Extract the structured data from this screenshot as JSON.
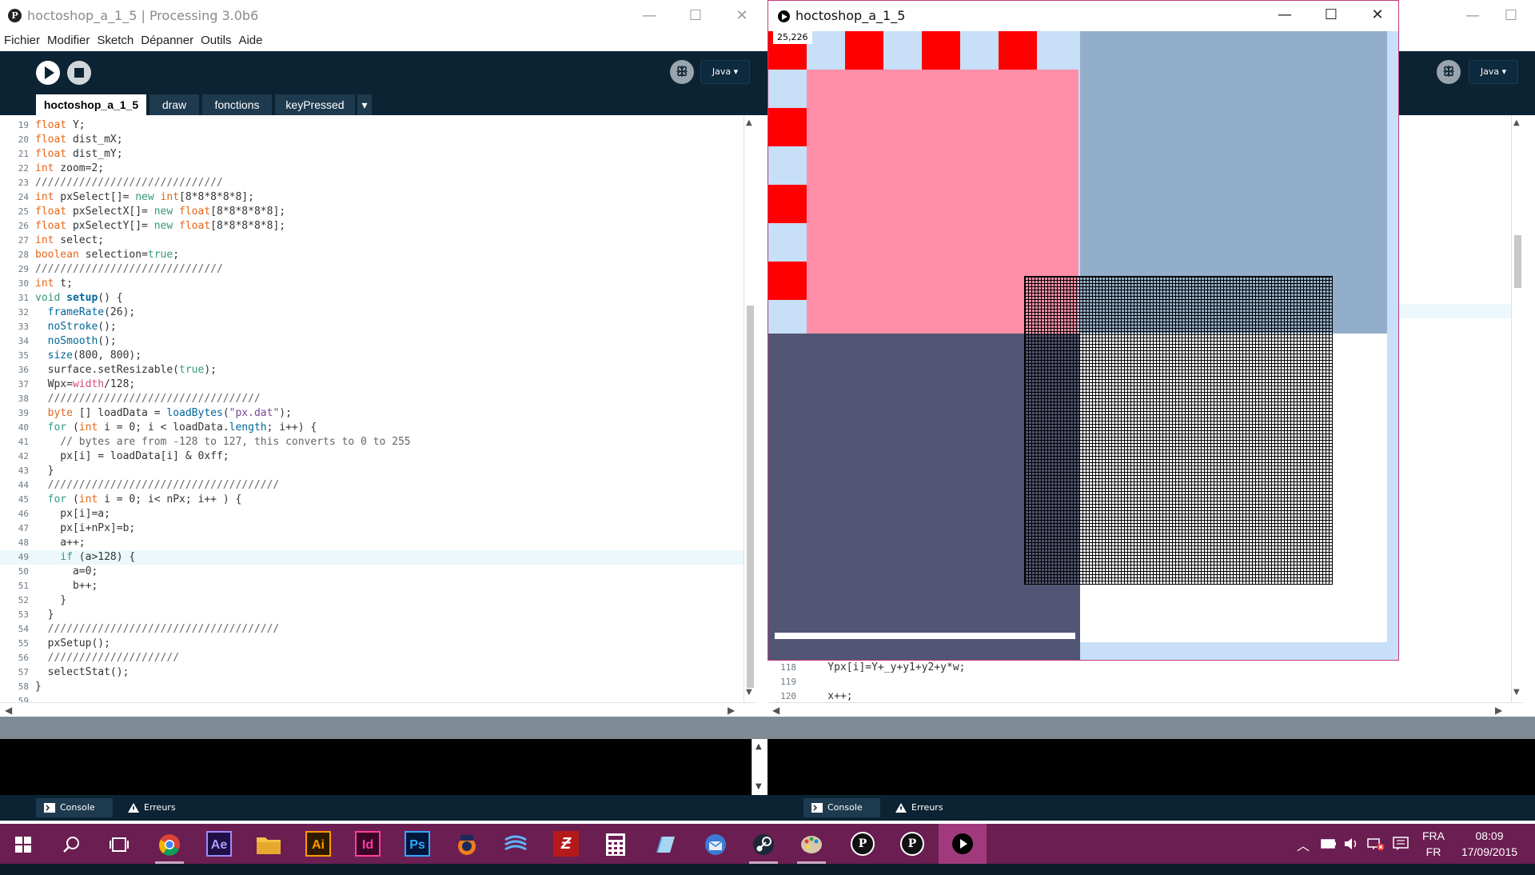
{
  "left_window": {
    "title": "hoctoshop_a_1_5 | Processing 3.0b6",
    "menu": [
      "Fichier",
      "Modifier",
      "Sketch",
      "Dépanner",
      "Outils",
      "Aide"
    ],
    "mode": "Java ▾",
    "tabs": [
      "hoctoshop_a_1_5",
      "draw",
      "fonctions",
      "keyPressed"
    ],
    "tab_overflow": "▾",
    "code_lines": [
      {
        "n": "19",
        "html": "<span class='ty'>float</span> Y;"
      },
      {
        "n": "20",
        "html": "<span class='ty'>float</span> dist_mX;"
      },
      {
        "n": "21",
        "html": "<span class='ty'>float</span> dist_mY;"
      },
      {
        "n": "22",
        "html": "<span class='ty'>int</span> zoom=2;"
      },
      {
        "n": "23",
        "html": "<span class='cmt'>//////////////////////////////</span>"
      },
      {
        "n": "24",
        "html": "<span class='ty'>int</span> pxSelect[]= <span class='kw'>new</span> <span class='ty'>int</span>[8*8*8*8*8];"
      },
      {
        "n": "25",
        "html": "<span class='ty'>float</span> pxSelectX[]= <span class='kw'>new</span> <span class='ty'>float</span>[8*8*8*8*8];"
      },
      {
        "n": "26",
        "html": "<span class='ty'>float</span> pxSelectY[]= <span class='kw'>new</span> <span class='ty'>float</span>[8*8*8*8*8];"
      },
      {
        "n": "27",
        "html": "<span class='ty'>int</span> select;"
      },
      {
        "n": "28",
        "html": "<span class='ty'>boolean</span> selection=<span class='kw'>true</span>;"
      },
      {
        "n": "29",
        "html": "<span class='cmt'>//////////////////////////////</span>"
      },
      {
        "n": "30",
        "html": "<span class='ty'>int</span> t;"
      },
      {
        "n": "31",
        "html": "<span class='kw'>void</span> <span class='fnb'>setup</span>() {"
      },
      {
        "n": "32",
        "html": "  <span class='fn'>frameRate</span>(26);"
      },
      {
        "n": "33",
        "html": "  <span class='fn'>noStroke</span>();"
      },
      {
        "n": "34",
        "html": "  <span class='fn'>noSmooth</span>();"
      },
      {
        "n": "35",
        "html": "  <span class='fn'>size</span>(800, 800);"
      },
      {
        "n": "36",
        "html": "  surface.setResizable(<span class='kw'>true</span>);"
      },
      {
        "n": "37",
        "html": "  Wpx=<span class='cst'>width</span>/128;"
      },
      {
        "n": "38",
        "html": "  <span class='cmt'>//////////////////////////////////</span>"
      },
      {
        "n": "39",
        "html": "  <span class='ty'>byte</span> [] loadData = <span class='fn'>loadBytes</span>(<span class='str'>\"px.dat\"</span>);"
      },
      {
        "n": "40",
        "html": "  <span class='kw'>for</span> (<span class='ty'>int</span> i = 0; i &lt; loadData.<span class='fn'>length</span>; i++) {"
      },
      {
        "n": "41",
        "html": "    <span class='cmt'>// bytes are from -128 to 127, this converts to 0 to 255</span>"
      },
      {
        "n": "42",
        "html": "    px[i] = loadData[i] &amp; 0xff;"
      },
      {
        "n": "43",
        "html": "  }"
      },
      {
        "n": "44",
        "html": "  <span class='cmt'>/////////////////////////////////////</span>"
      },
      {
        "n": "45",
        "html": "  <span class='kw'>for</span> (<span class='ty'>int</span> i = 0; i&lt; nPx; i++ ) {"
      },
      {
        "n": "46",
        "html": "    px[i]=a;"
      },
      {
        "n": "47",
        "html": "    px[i+nPx]=b;"
      },
      {
        "n": "48",
        "html": "    a++;"
      },
      {
        "n": "49",
        "html": "    <span class='kw'>if</span> (a&gt;128) {",
        "current": true
      },
      {
        "n": "50",
        "html": "      a=0;"
      },
      {
        "n": "51",
        "html": "      b++;"
      },
      {
        "n": "52",
        "html": "    }"
      },
      {
        "n": "53",
        "html": "  }"
      },
      {
        "n": "54",
        "html": "  <span class='cmt'>/////////////////////////////////////</span>"
      },
      {
        "n": "55",
        "html": "  pxSetup();"
      },
      {
        "n": "56",
        "html": "  <span class='cmt'>/////////////////////</span>"
      },
      {
        "n": "57",
        "html": "  selectStat();"
      },
      {
        "n": "58",
        "html": "}"
      },
      {
        "n": "59",
        "html": ""
      }
    ],
    "console_tab": "Console",
    "errors_tab": "Erreurs"
  },
  "right_window": {
    "mode": "Java ▾",
    "code_lines": [
      {
        "n": "118",
        "html": "    Ypx[i]=Y+_y+y1+y2+y*w;"
      },
      {
        "n": "119",
        "html": ""
      },
      {
        "n": "120",
        "html": "    x++;"
      }
    ],
    "console_tab": "Console",
    "errors_tab": "Erreurs"
  },
  "sketch_window": {
    "title": "hoctoshop_a_1_5",
    "coord_readout": "25,226",
    "colors": {
      "background": "#c7dff7",
      "red": "#ff0000",
      "pink": "#ff8fa8",
      "steel_blue": "#92aecb",
      "slate": "#525674",
      "white": "#ffffff"
    }
  },
  "taskbar": {
    "apps": [
      "Ae",
      "Ai",
      "Id",
      "Ps"
    ],
    "lang_top": "FRA",
    "lang_bottom": "FR",
    "time": "08:09",
    "date": "17/09/2015"
  }
}
